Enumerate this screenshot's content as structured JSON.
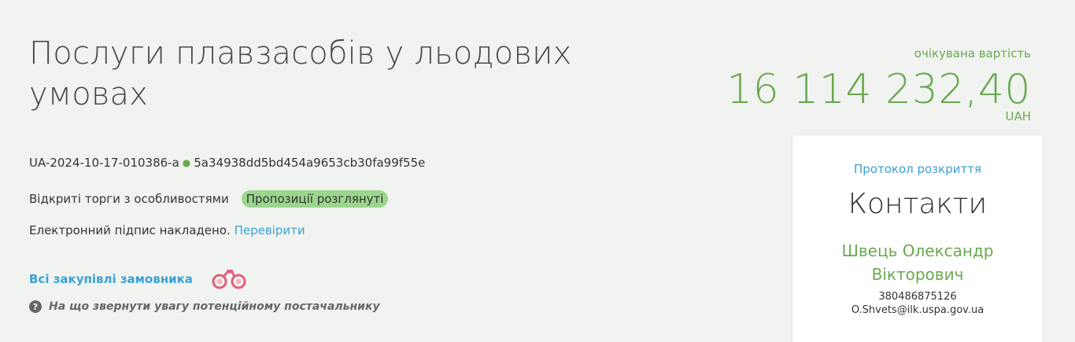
{
  "tender": {
    "title": "Послуги плавзасобів у льодових умовах",
    "id": "UA-2024-10-17-010386-a",
    "hash": "5a34938dd5bd454a9653cb30fa99f55e",
    "procedure_type": "Відкриті торги з особливостями",
    "status": "Пропозиції розглянуті",
    "status_color": "#9bd68f"
  },
  "signature": {
    "text": "Електронний підпис накладено.",
    "verify_label": "Перевірити"
  },
  "links": {
    "all_buyer_purchases": "Всі закупівлі замовника",
    "hint": "На що звернути увагу потенційному постачальнику",
    "binoculars_icon": "binoculars-icon",
    "hint_icon": "question-circle-icon"
  },
  "price": {
    "label": "очікувана вартість",
    "value": "16 114 232,40",
    "currency": "UAH",
    "color": "#6aa84f"
  },
  "contact_card": {
    "protocol_link": "Протокол розкриття",
    "title": "Контакти",
    "name_line1": "Швець Олександр",
    "name_line2": "Вікторович",
    "phone": "380486875126",
    "email": "O.Shvets@ilk.uspa.gov.ua"
  },
  "colors": {
    "link": "#3aa1d4",
    "accent_green": "#6aa84f",
    "background": "#f0f3f0"
  }
}
